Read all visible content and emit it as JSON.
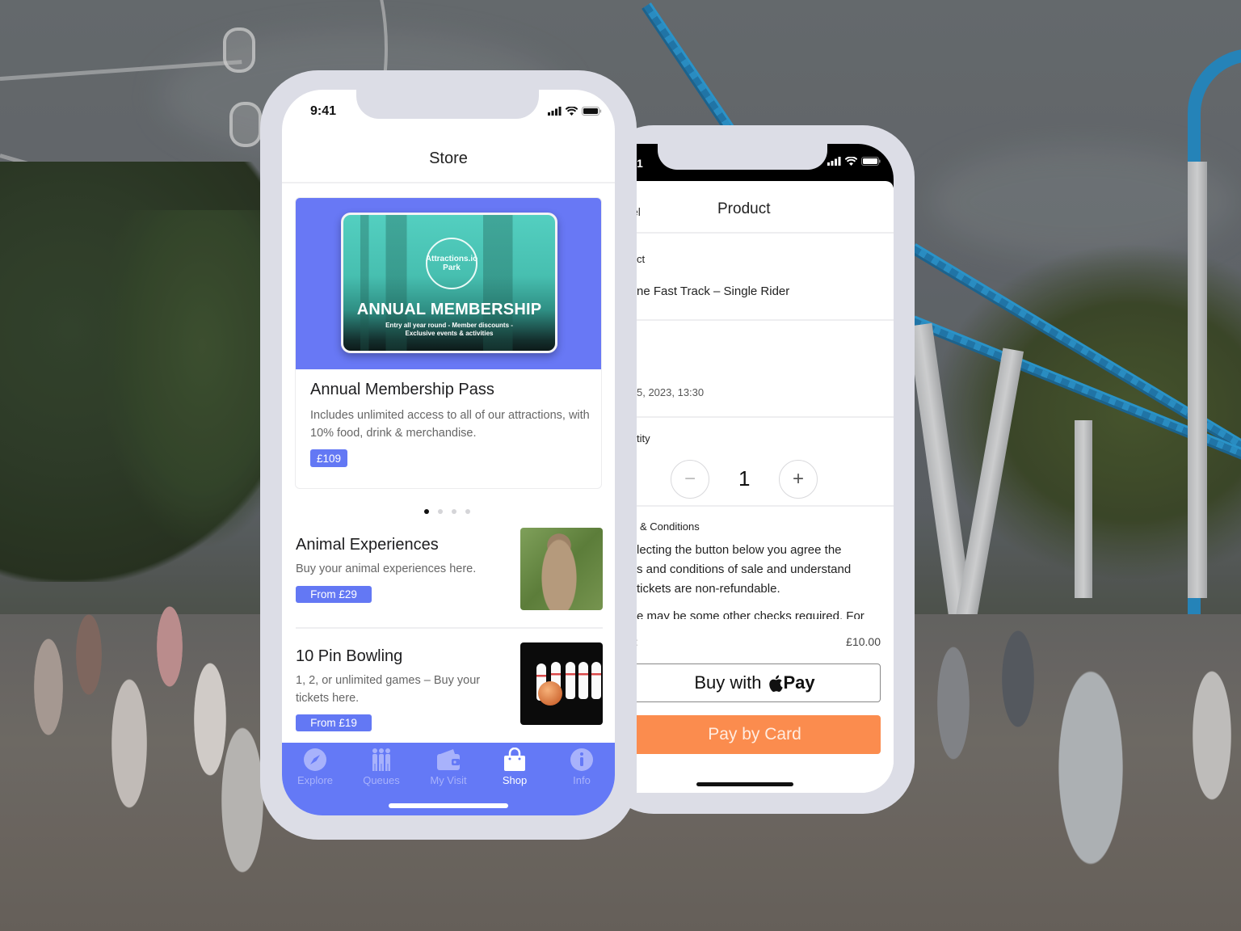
{
  "colors": {
    "brand_blue": "#6479f6",
    "pay_by_card_orange": "#fb8c4e",
    "phone_frame": "#dcdde6"
  },
  "front_phone": {
    "status_bar": {
      "time": "9:41",
      "icons": [
        "signal-icon",
        "wifi-icon",
        "battery-icon"
      ]
    },
    "header": {
      "title": "Store"
    },
    "featured": {
      "card_image": {
        "logo_line1": "Attractions.io",
        "logo_line2": "Park",
        "heading": "ANNUAL MEMBERSHIP",
        "subline1": "Entry all year round - Member discounts -",
        "subline2": "Exclusive events & activities"
      },
      "title": "Annual Membership Pass",
      "description": "Includes unlimited access to all of our attractions, with 10% food, drink & merchandise.",
      "price": "£109"
    },
    "carousel": {
      "total_pages": 4,
      "active_page": 1
    },
    "items": [
      {
        "title": "Animal Experiences",
        "description": "Buy your animal experiences here.",
        "price": "From £29",
        "image": "meerkat"
      },
      {
        "title": "10 Pin Bowling",
        "description": "1, 2, or unlimited games – Buy your tickets here.",
        "price": "From £19",
        "image": "bowling-pins"
      }
    ],
    "tabbar": {
      "active": "Shop",
      "tabs": [
        {
          "label": "Explore",
          "icon": "compass-icon"
        },
        {
          "label": "Queues",
          "icon": "people-queue-icon"
        },
        {
          "label": "My Visit",
          "icon": "wallet-icon"
        },
        {
          "label": "Shop",
          "icon": "shopping-bag-icon"
        },
        {
          "label": "Info",
          "icon": "info-icon"
        }
      ]
    }
  },
  "back_phone": {
    "status_bar": {
      "time_partial": "1",
      "icons": [
        "signal-icon",
        "wifi-icon",
        "battery-icon"
      ]
    },
    "header": {
      "cancel_partial": "el",
      "title": "Product"
    },
    "product_section": {
      "label_partial": "ct",
      "value_partial": "ne Fast Track – Single Rider"
    },
    "date_section": {
      "value_partial": "5, 2023, 13:30"
    },
    "quantity_section": {
      "label_partial": "tity",
      "value": "1",
      "minus": "−",
      "plus": "+"
    },
    "terms_section": {
      "label_partial": "& Conditions",
      "lines": [
        "lecting the button below you agree the",
        "s and conditions of sale and understand",
        "tickets are non-refundable.",
        "e may be some other checks required. For"
      ]
    },
    "total": {
      "label_partial": ":",
      "price": "£10.00"
    },
    "apple_pay": {
      "label": "Buy with",
      "pay_word": "Pay"
    },
    "card_button": {
      "label": "Pay by Card"
    }
  }
}
